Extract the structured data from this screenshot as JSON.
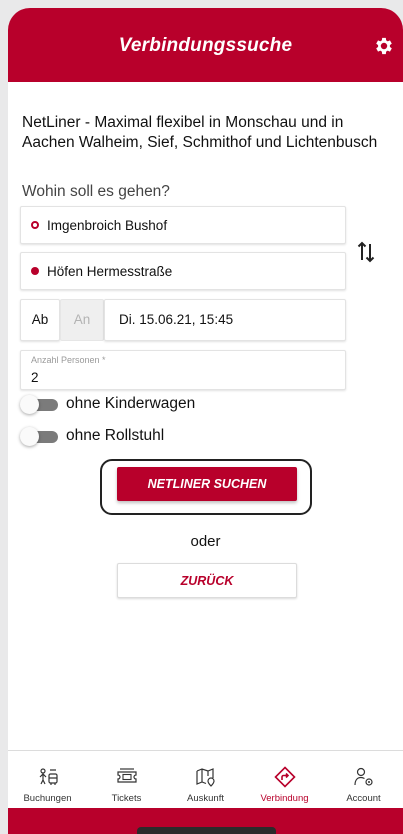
{
  "header": {
    "title": "Verbindungssuche"
  },
  "intro_text": "NetLiner - Maximal flexibel in Monschau und in Aachen Walheim, Sief, Schmithof und Lichtenbusch",
  "question": "Wohin soll es gehen?",
  "trip": {
    "from": "Imgenbroich Bushof",
    "to": "Höfen Hermesstraße",
    "mode_departure": "Ab",
    "mode_arrival": "An",
    "datetime": "Di. 15.06.21, 15:45"
  },
  "persons": {
    "label": "Anzahl Personen *",
    "value": "2"
  },
  "options": [
    {
      "label": "ohne Kinderwagen",
      "enabled": false
    },
    {
      "label": "ohne Rollstuhl",
      "enabled": false
    }
  ],
  "actions": {
    "search_label": "NETLINER SUCHEN",
    "or_label": "oder",
    "back_label": "ZURÜCK"
  },
  "nav": {
    "items": [
      {
        "label": "Buchungen",
        "icon": "bookings-icon"
      },
      {
        "label": "Tickets",
        "icon": "ticket-icon"
      },
      {
        "label": "Auskunft",
        "icon": "map-info-icon"
      },
      {
        "label": "Verbindung",
        "icon": "route-icon",
        "active": true
      },
      {
        "label": "Account",
        "icon": "account-settings-icon"
      }
    ]
  },
  "colors": {
    "brand": "#b8002b",
    "toggle_off": "#7b7b7b"
  }
}
